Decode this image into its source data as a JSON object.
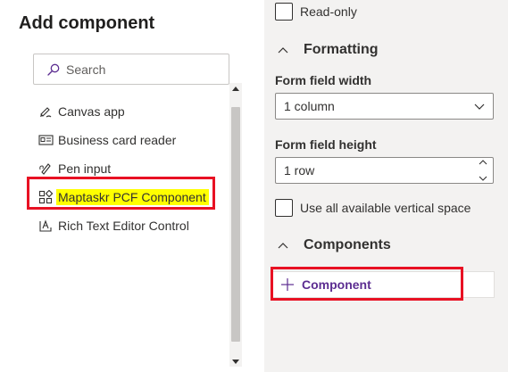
{
  "left_panel": {
    "title": "Add component",
    "search": {
      "placeholder": "Search",
      "value": ""
    },
    "components": [
      {
        "label": "Canvas app",
        "icon": "canvas-app-icon",
        "highlighted": false
      },
      {
        "label": "Business card reader",
        "icon": "business-card-icon",
        "highlighted": false
      },
      {
        "label": "Pen input",
        "icon": "pen-input-icon",
        "highlighted": false
      },
      {
        "label": "Maptaskr PCF Component",
        "icon": "pcf-component-icon",
        "highlighted": true
      },
      {
        "label": "Rich Text Editor Control",
        "icon": "rich-text-icon",
        "highlighted": false
      }
    ]
  },
  "right_panel": {
    "read_only_label": "Read-only",
    "formatting": {
      "header": "Formatting",
      "width_label": "Form field width",
      "width_value": "1 column",
      "height_label": "Form field height",
      "height_value": "1 row",
      "vertical_space_label": "Use all available vertical space"
    },
    "components": {
      "header": "Components",
      "add_label": "Component"
    }
  },
  "colors": {
    "highlight": "#ffff00",
    "annotation_red": "#e81123",
    "accent_purple": "#5c2d91",
    "right_panel_bg": "#f3f2f1"
  }
}
